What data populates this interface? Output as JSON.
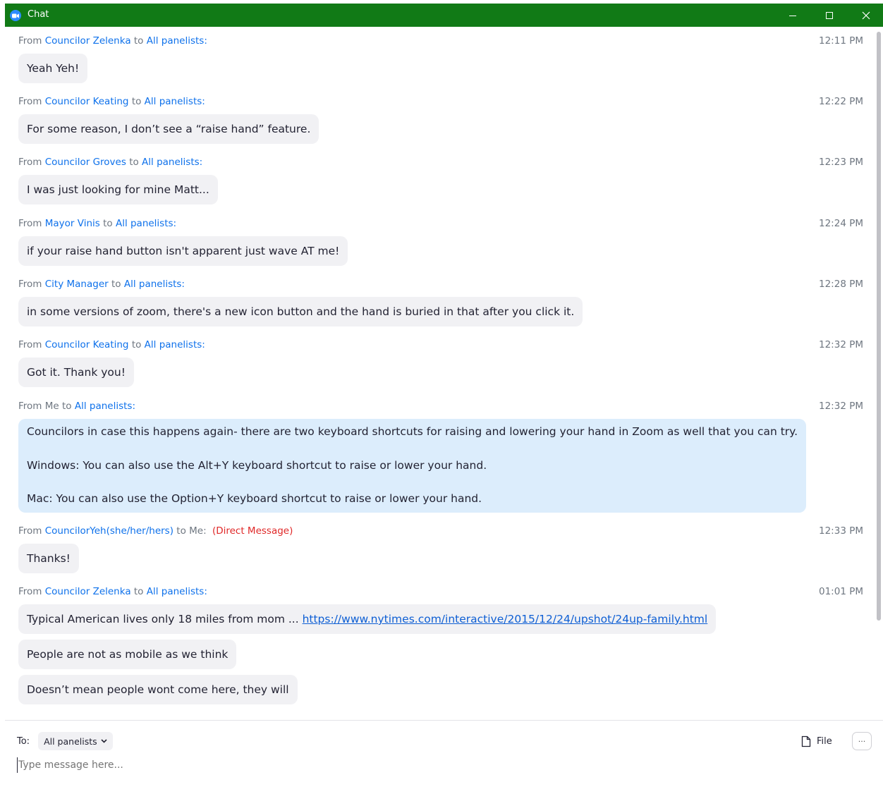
{
  "window": {
    "title": "Chat",
    "controls": {
      "minimize": "–",
      "maximize": "□",
      "close": "✕"
    },
    "accent": "#117a16"
  },
  "messages": [
    {
      "from": "Councilor Zelenka",
      "to": "All panelists:",
      "time": "12:11 PM",
      "bubbles": [
        "Yeah Yeh!"
      ]
    },
    {
      "from": "Councilor Keating",
      "to": "All panelists:",
      "time": "12:22 PM",
      "bubbles": [
        "For some reason, I don’t see a “raise hand” feature."
      ]
    },
    {
      "from": "Councilor Groves",
      "to": "All panelists:",
      "time": "12:23 PM",
      "bubbles": [
        "I was just looking for mine Matt..."
      ]
    },
    {
      "from": "Mayor Vinis",
      "to": "All panelists:",
      "time": "12:24 PM",
      "bubbles": [
        "if your raise hand button isn't apparent just wave AT me!"
      ]
    },
    {
      "from": "City Manager",
      "to": "All panelists:",
      "time": "12:28 PM",
      "bubbles": [
        "in some versions of zoom, there's a new icon button and the hand is buried in that after you click it."
      ]
    },
    {
      "from": "Councilor Keating",
      "to": "All panelists:",
      "time": "12:32 PM",
      "bubbles": [
        "Got it. Thank you!"
      ]
    },
    {
      "from": "Me",
      "to": "All panelists:",
      "time": "12:32 PM",
      "lines": [
        "Councilors in case this happens again- there are two keyboard shortcuts for raising and lowering your hand in Zoom as well that you can try.",
        "Windows: You can also use the Alt+Y keyboard shortcut to raise or lower your hand.",
        "Mac: You can also use the Option+Y keyboard shortcut to raise or lower your hand."
      ]
    },
    {
      "from": "CouncilorYeh(she/her/hers)",
      "to": "Me:",
      "dm": "(Direct Message)",
      "time": "12:33 PM",
      "bubbles": [
        "Thanks!"
      ]
    },
    {
      "from": "Councilor Zelenka",
      "to": "All panelists:",
      "time": "01:01 PM",
      "bubble_with_link": {
        "text": "Typical American lives only 18 miles from mom ... ",
        "link": "https://www.nytimes.com/interactive/2015/12/24/upshot/24up-family.html"
      },
      "bubbles": [
        "People are not as mobile as we think",
        "Doesn’t mean people wont come here, they will"
      ]
    }
  ],
  "labels": {
    "from": "From",
    "to": "to"
  },
  "compose": {
    "to_label": "To:",
    "recipient": "All panelists",
    "file_label": "File",
    "more_label": "···",
    "placeholder": "Type message here..."
  },
  "icons": {
    "app": "zoom-camera-icon",
    "recipient_dropdown": "chevron-down-icon",
    "file": "file-icon",
    "more": "more-options-icon"
  }
}
